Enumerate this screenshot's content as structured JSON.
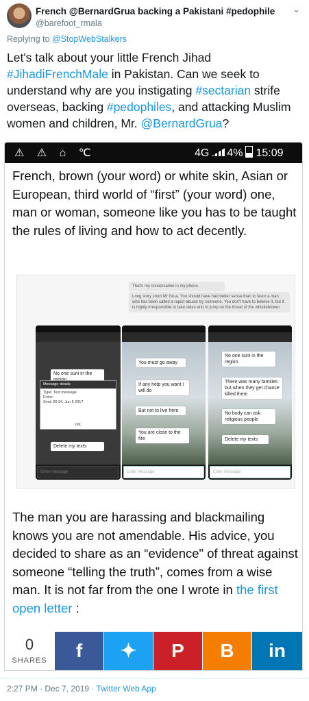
{
  "tweet": {
    "author_name": "French @BernardGrua backing a Pakistani #pedophile",
    "author_handle": "@barefoot_rmala",
    "replying_prefix": "Replying to ",
    "replying_to": "@StopWebStalkers",
    "text_parts": [
      "Let's talk about your little French Jihad ",
      "#JihadiFrenchMale",
      " in Pakistan. Can we seek to understand why are you instigating ",
      "#sectarian",
      " strife overseas, backing ",
      "#pedophiles",
      ", and attacking Muslim women and children, Mr. ",
      "@BernardGrua",
      "?"
    ],
    "timestamp": "2:27 PM · Dec 7, 2019",
    "separator": " · ",
    "source": "Twitter Web App"
  },
  "screenshot": {
    "status_icons": "⚠ ⚠ ⌂ ℃",
    "network": "4G",
    "battery": "4%",
    "time": "15:09",
    "paragraph1": "French, brown (your word) or white skin, Asian or European, third world of “first” (your word) one, man or woman, someone like you has to be taught the rules of living and how to act decently.",
    "paragraph2_prefix": "The man you are harassing and blackmailing knows you are not amendable. His advice, you decided to share as an “evidence\" of threat against someone “telling the truth”, comes from a wise man. It is not far from the one I wrote in ",
    "paragraph2_link": "the first open letter",
    "paragraph2_suffix": " :",
    "inner": {
      "note_top": "That's my conversation in my phone.",
      "note_body": "Long story short Mr Grua. You should have had better sense than to favor a man who has been called a rapist-abuser by someone. You don't have to believe it, but it is highly irresponsible to take sides and to jump on the throat of the whistleblower",
      "dialog_title": "Message details",
      "dialog_body": "Type: Text message\nFrom:\nSent: 20:34, Jun 5 2017",
      "dialog_ok": "OK",
      "left_msgs": [
        "No one suni in the region",
        "Delete my texts"
      ],
      "mid_msgs": [
        "You must go away",
        "If any help you want I will do",
        "But not to live here",
        "You are close to the fire"
      ],
      "right_msgs": [
        "No one suni in the region",
        "There was many families but when they get chance killed them",
        "No body can ask religious people",
        "Delete my texts"
      ],
      "input_placeholder": "Enter message",
      "left_placeholder": "Enter message"
    }
  },
  "share": {
    "count": "0",
    "label": "SHARES",
    "buttons": [
      {
        "icon": "facebook-icon",
        "glyph": "f",
        "color": "#3b5998"
      },
      {
        "icon": "twitter-icon",
        "glyph": "✦",
        "color": "#1da1f2"
      },
      {
        "icon": "pinterest-icon",
        "glyph": "P",
        "color": "#cb2027"
      },
      {
        "icon": "blogger-icon",
        "glyph": "B",
        "color": "#f57d00"
      },
      {
        "icon": "linkedin-icon",
        "glyph": "in",
        "color": "#0077b5"
      }
    ]
  }
}
